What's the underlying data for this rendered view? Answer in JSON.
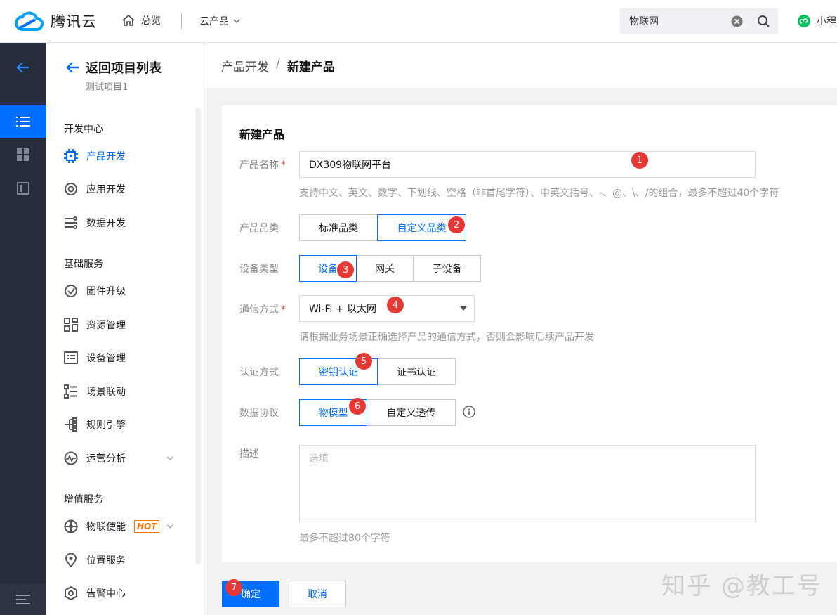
{
  "topbar": {
    "brand": "腾讯云",
    "home_label": "总览",
    "products_label": "云产品",
    "search_value": "物联网",
    "mini_program_label": "小程"
  },
  "sidebar": {
    "back_label": "返回项目列表",
    "project_name": "测试项目1",
    "groups": [
      {
        "title": "开发中心",
        "items": [
          {
            "label": "产品开发",
            "icon": "chip-icon",
            "active": true
          },
          {
            "label": "应用开发",
            "icon": "app-dev-icon"
          },
          {
            "label": "数据开发",
            "icon": "data-flow-icon"
          }
        ]
      },
      {
        "title": "基础服务",
        "items": [
          {
            "label": "固件升级",
            "icon": "firmware-icon"
          },
          {
            "label": "资源管理",
            "icon": "resource-icon"
          },
          {
            "label": "设备管理",
            "icon": "device-list-icon"
          },
          {
            "label": "场景联动",
            "icon": "scene-icon"
          },
          {
            "label": "规则引擎",
            "icon": "rule-engine-icon"
          },
          {
            "label": "运营分析",
            "icon": "analytics-icon"
          }
        ]
      },
      {
        "title": "增值服务",
        "items": [
          {
            "label": "物联使能",
            "icon": "enable-icon",
            "badge": "HOT"
          },
          {
            "label": "位置服务",
            "icon": "location-icon"
          },
          {
            "label": "告警中心",
            "icon": "alarm-icon"
          }
        ]
      }
    ]
  },
  "breadcrumb": {
    "parent": "产品开发",
    "separator": "/",
    "current": "新建产品"
  },
  "form": {
    "title": "新建产品",
    "product_name": {
      "label": "产品名称",
      "value": "DX309物联网平台",
      "hint": "支持中文、英文、数字、下划线、空格（非首尾字符）、中英文括号、-、@、\\、/的组合，最多不超过40个字符"
    },
    "category": {
      "label": "产品品类",
      "options": [
        "标准品类",
        "自定义品类"
      ],
      "selected": 1
    },
    "device_type": {
      "label": "设备类型",
      "options": [
        "设备",
        "网关",
        "子设备"
      ],
      "selected": 0
    },
    "comm": {
      "label": "通信方式",
      "value": "Wi-Fi + 以太网",
      "hint": "请根据业务场景正确选择产品的通信方式，否则会影响后续产品开发"
    },
    "auth": {
      "label": "认证方式",
      "options": [
        "密钥认证",
        "证书认证"
      ],
      "selected": 0
    },
    "protocol": {
      "label": "数据协议",
      "options": [
        "物模型",
        "自定义透传"
      ],
      "selected": 0
    },
    "description": {
      "label": "描述",
      "placeholder": "选填",
      "hint": "最多不超过80个字符"
    }
  },
  "actions": {
    "confirm": "确定",
    "cancel": "取消"
  },
  "annotations": [
    "1",
    "2",
    "3",
    "4",
    "5",
    "6",
    "7"
  ],
  "watermark": "知乎 @教工号",
  "colors": {
    "accent": "#006eff",
    "rail": "#262d3c",
    "badge": "#e53935",
    "hot": "#ff7200"
  }
}
